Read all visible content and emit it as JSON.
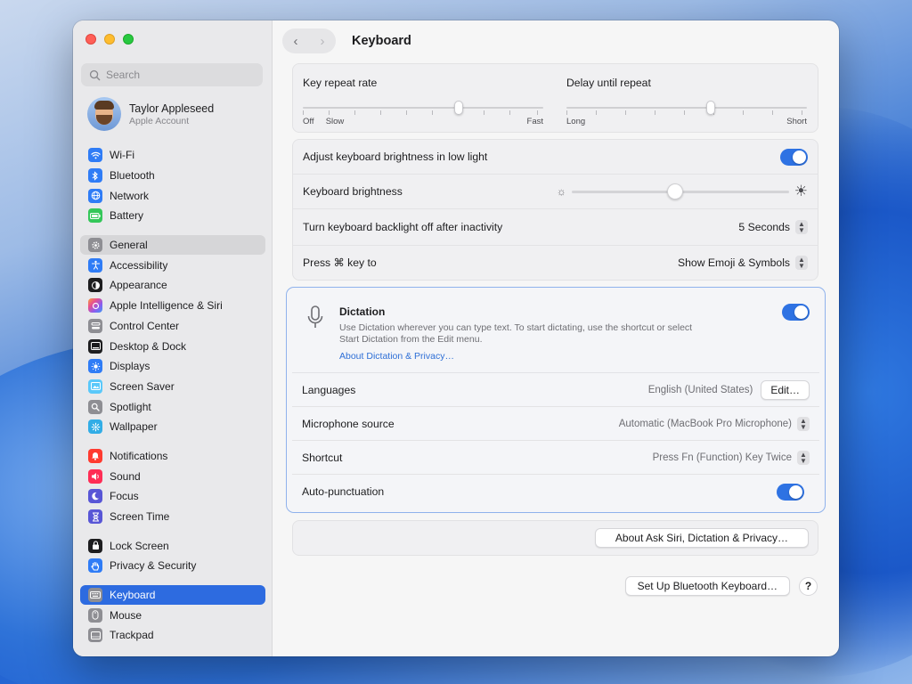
{
  "window": {
    "title": "Keyboard"
  },
  "sidebar": {
    "search_placeholder": "Search",
    "account": {
      "name": "Taylor Appleseed",
      "subtitle": "Apple Account"
    },
    "items": [
      {
        "label": "Wi-Fi",
        "icon": "wifi-icon",
        "color": "#2f7cf6"
      },
      {
        "label": "Bluetooth",
        "icon": "bluetooth-icon",
        "color": "#2f7cf6"
      },
      {
        "label": "Network",
        "icon": "globe-icon",
        "color": "#2f7cf6"
      },
      {
        "label": "Battery",
        "icon": "battery-icon",
        "color": "#34c759"
      },
      {
        "label": "General",
        "icon": "gear-icon",
        "color": "#8e8e93"
      },
      {
        "label": "Accessibility",
        "icon": "accessibility-icon",
        "color": "#2f7cf6"
      },
      {
        "label": "Appearance",
        "icon": "appearance-icon",
        "color": "#1d1d1f"
      },
      {
        "label": "Apple Intelligence & Siri",
        "icon": "siri-icon",
        "color": "#d957c9"
      },
      {
        "label": "Control Center",
        "icon": "control-center-icon",
        "color": "#8e8e93"
      },
      {
        "label": "Desktop & Dock",
        "icon": "dock-icon",
        "color": "#1d1d1f"
      },
      {
        "label": "Displays",
        "icon": "sun-icon",
        "color": "#2f7cf6"
      },
      {
        "label": "Screen Saver",
        "icon": "screen-saver-icon",
        "color": "#5ac8fa"
      },
      {
        "label": "Spotlight",
        "icon": "magnifier-icon",
        "color": "#8e8e93"
      },
      {
        "label": "Wallpaper",
        "icon": "flower-icon",
        "color": "#32ade6"
      },
      {
        "label": "Notifications",
        "icon": "bell-icon",
        "color": "#ff3b30"
      },
      {
        "label": "Sound",
        "icon": "speaker-icon",
        "color": "#ff2d55"
      },
      {
        "label": "Focus",
        "icon": "moon-icon",
        "color": "#5856d6"
      },
      {
        "label": "Screen Time",
        "icon": "hourglass-icon",
        "color": "#5856d6"
      },
      {
        "label": "Lock Screen",
        "icon": "lock-icon",
        "color": "#1d1d1f"
      },
      {
        "label": "Privacy & Security",
        "icon": "hand-icon",
        "color": "#2f7cf6"
      },
      {
        "label": "Keyboard",
        "icon": "keyboard-icon",
        "color": "#8e8e93"
      },
      {
        "label": "Mouse",
        "icon": "mouse-icon",
        "color": "#8e8e93"
      },
      {
        "label": "Trackpad",
        "icon": "trackpad-icon",
        "color": "#8e8e93"
      }
    ]
  },
  "sliders": {
    "key_repeat": {
      "label": "Key repeat rate",
      "left": "Off",
      "left2": "Slow",
      "right": "Fast",
      "value": 0.67
    },
    "delay_repeat": {
      "label": "Delay until repeat",
      "left": "Long",
      "right": "Short",
      "value": 0.6
    }
  },
  "settings": {
    "adjust_brightness": {
      "label": "Adjust keyboard brightness in low light",
      "on": true
    },
    "keyboard_brightness": {
      "label": "Keyboard brightness",
      "value": 0.49
    },
    "backlight_off": {
      "label": "Turn keyboard backlight off after inactivity",
      "value": "5 Seconds"
    },
    "press_key": {
      "label": "Press ⌘ key to",
      "value": "Show Emoji & Symbols"
    }
  },
  "dictation": {
    "title": "Dictation",
    "description_line1": "Use Dictation wherever you can type text. To start dictating, use the shortcut or select",
    "description_line2": "Start Dictation from the Edit menu.",
    "link": "About Dictation & Privacy…",
    "on": true,
    "languages": {
      "label": "Languages",
      "value": "English (United States)",
      "button": "Edit…"
    },
    "microphone": {
      "label": "Microphone source",
      "value": "Automatic (MacBook Pro Microphone)"
    },
    "shortcut": {
      "label": "Shortcut",
      "value": "Press Fn (Function) Key Twice"
    },
    "auto_punct": {
      "label": "Auto-punctuation",
      "on": true
    }
  },
  "buttons": {
    "about_siri": "About Ask Siri, Dictation & Privacy…",
    "setup_bt": "Set Up Bluetooth Keyboard…",
    "help": "?"
  },
  "colors": {
    "accent": "#2e72e3",
    "selected": "#2d6be0"
  }
}
